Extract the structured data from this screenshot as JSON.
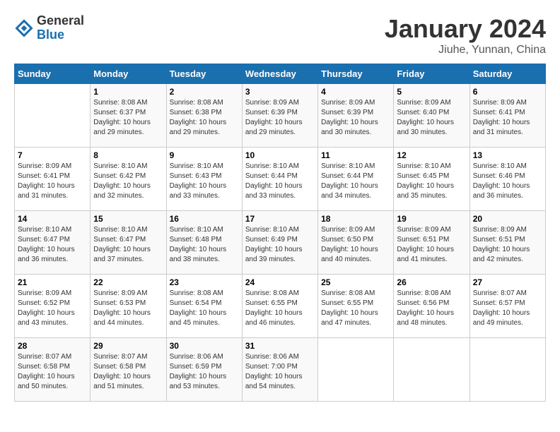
{
  "header": {
    "logo_general": "General",
    "logo_blue": "Blue",
    "month_title": "January 2024",
    "location": "Jiuhe, Yunnan, China"
  },
  "weekdays": [
    "Sunday",
    "Monday",
    "Tuesday",
    "Wednesday",
    "Thursday",
    "Friday",
    "Saturday"
  ],
  "weeks": [
    [
      {
        "day": "",
        "sunrise": "",
        "sunset": "",
        "daylight": ""
      },
      {
        "day": "1",
        "sunrise": "Sunrise: 8:08 AM",
        "sunset": "Sunset: 6:37 PM",
        "daylight": "Daylight: 10 hours and 29 minutes."
      },
      {
        "day": "2",
        "sunrise": "Sunrise: 8:08 AM",
        "sunset": "Sunset: 6:38 PM",
        "daylight": "Daylight: 10 hours and 29 minutes."
      },
      {
        "day": "3",
        "sunrise": "Sunrise: 8:09 AM",
        "sunset": "Sunset: 6:39 PM",
        "daylight": "Daylight: 10 hours and 29 minutes."
      },
      {
        "day": "4",
        "sunrise": "Sunrise: 8:09 AM",
        "sunset": "Sunset: 6:39 PM",
        "daylight": "Daylight: 10 hours and 30 minutes."
      },
      {
        "day": "5",
        "sunrise": "Sunrise: 8:09 AM",
        "sunset": "Sunset: 6:40 PM",
        "daylight": "Daylight: 10 hours and 30 minutes."
      },
      {
        "day": "6",
        "sunrise": "Sunrise: 8:09 AM",
        "sunset": "Sunset: 6:41 PM",
        "daylight": "Daylight: 10 hours and 31 minutes."
      }
    ],
    [
      {
        "day": "7",
        "sunrise": "Sunrise: 8:09 AM",
        "sunset": "Sunset: 6:41 PM",
        "daylight": "Daylight: 10 hours and 31 minutes."
      },
      {
        "day": "8",
        "sunrise": "Sunrise: 8:10 AM",
        "sunset": "Sunset: 6:42 PM",
        "daylight": "Daylight: 10 hours and 32 minutes."
      },
      {
        "day": "9",
        "sunrise": "Sunrise: 8:10 AM",
        "sunset": "Sunset: 6:43 PM",
        "daylight": "Daylight: 10 hours and 33 minutes."
      },
      {
        "day": "10",
        "sunrise": "Sunrise: 8:10 AM",
        "sunset": "Sunset: 6:44 PM",
        "daylight": "Daylight: 10 hours and 33 minutes."
      },
      {
        "day": "11",
        "sunrise": "Sunrise: 8:10 AM",
        "sunset": "Sunset: 6:44 PM",
        "daylight": "Daylight: 10 hours and 34 minutes."
      },
      {
        "day": "12",
        "sunrise": "Sunrise: 8:10 AM",
        "sunset": "Sunset: 6:45 PM",
        "daylight": "Daylight: 10 hours and 35 minutes."
      },
      {
        "day": "13",
        "sunrise": "Sunrise: 8:10 AM",
        "sunset": "Sunset: 6:46 PM",
        "daylight": "Daylight: 10 hours and 36 minutes."
      }
    ],
    [
      {
        "day": "14",
        "sunrise": "Sunrise: 8:10 AM",
        "sunset": "Sunset: 6:47 PM",
        "daylight": "Daylight: 10 hours and 36 minutes."
      },
      {
        "day": "15",
        "sunrise": "Sunrise: 8:10 AM",
        "sunset": "Sunset: 6:47 PM",
        "daylight": "Daylight: 10 hours and 37 minutes."
      },
      {
        "day": "16",
        "sunrise": "Sunrise: 8:10 AM",
        "sunset": "Sunset: 6:48 PM",
        "daylight": "Daylight: 10 hours and 38 minutes."
      },
      {
        "day": "17",
        "sunrise": "Sunrise: 8:10 AM",
        "sunset": "Sunset: 6:49 PM",
        "daylight": "Daylight: 10 hours and 39 minutes."
      },
      {
        "day": "18",
        "sunrise": "Sunrise: 8:09 AM",
        "sunset": "Sunset: 6:50 PM",
        "daylight": "Daylight: 10 hours and 40 minutes."
      },
      {
        "day": "19",
        "sunrise": "Sunrise: 8:09 AM",
        "sunset": "Sunset: 6:51 PM",
        "daylight": "Daylight: 10 hours and 41 minutes."
      },
      {
        "day": "20",
        "sunrise": "Sunrise: 8:09 AM",
        "sunset": "Sunset: 6:51 PM",
        "daylight": "Daylight: 10 hours and 42 minutes."
      }
    ],
    [
      {
        "day": "21",
        "sunrise": "Sunrise: 8:09 AM",
        "sunset": "Sunset: 6:52 PM",
        "daylight": "Daylight: 10 hours and 43 minutes."
      },
      {
        "day": "22",
        "sunrise": "Sunrise: 8:09 AM",
        "sunset": "Sunset: 6:53 PM",
        "daylight": "Daylight: 10 hours and 44 minutes."
      },
      {
        "day": "23",
        "sunrise": "Sunrise: 8:08 AM",
        "sunset": "Sunset: 6:54 PM",
        "daylight": "Daylight: 10 hours and 45 minutes."
      },
      {
        "day": "24",
        "sunrise": "Sunrise: 8:08 AM",
        "sunset": "Sunset: 6:55 PM",
        "daylight": "Daylight: 10 hours and 46 minutes."
      },
      {
        "day": "25",
        "sunrise": "Sunrise: 8:08 AM",
        "sunset": "Sunset: 6:55 PM",
        "daylight": "Daylight: 10 hours and 47 minutes."
      },
      {
        "day": "26",
        "sunrise": "Sunrise: 8:08 AM",
        "sunset": "Sunset: 6:56 PM",
        "daylight": "Daylight: 10 hours and 48 minutes."
      },
      {
        "day": "27",
        "sunrise": "Sunrise: 8:07 AM",
        "sunset": "Sunset: 6:57 PM",
        "daylight": "Daylight: 10 hours and 49 minutes."
      }
    ],
    [
      {
        "day": "28",
        "sunrise": "Sunrise: 8:07 AM",
        "sunset": "Sunset: 6:58 PM",
        "daylight": "Daylight: 10 hours and 50 minutes."
      },
      {
        "day": "29",
        "sunrise": "Sunrise: 8:07 AM",
        "sunset": "Sunset: 6:58 PM",
        "daylight": "Daylight: 10 hours and 51 minutes."
      },
      {
        "day": "30",
        "sunrise": "Sunrise: 8:06 AM",
        "sunset": "Sunset: 6:59 PM",
        "daylight": "Daylight: 10 hours and 53 minutes."
      },
      {
        "day": "31",
        "sunrise": "Sunrise: 8:06 AM",
        "sunset": "Sunset: 7:00 PM",
        "daylight": "Daylight: 10 hours and 54 minutes."
      },
      {
        "day": "",
        "sunrise": "",
        "sunset": "",
        "daylight": ""
      },
      {
        "day": "",
        "sunrise": "",
        "sunset": "",
        "daylight": ""
      },
      {
        "day": "",
        "sunrise": "",
        "sunset": "",
        "daylight": ""
      }
    ]
  ]
}
